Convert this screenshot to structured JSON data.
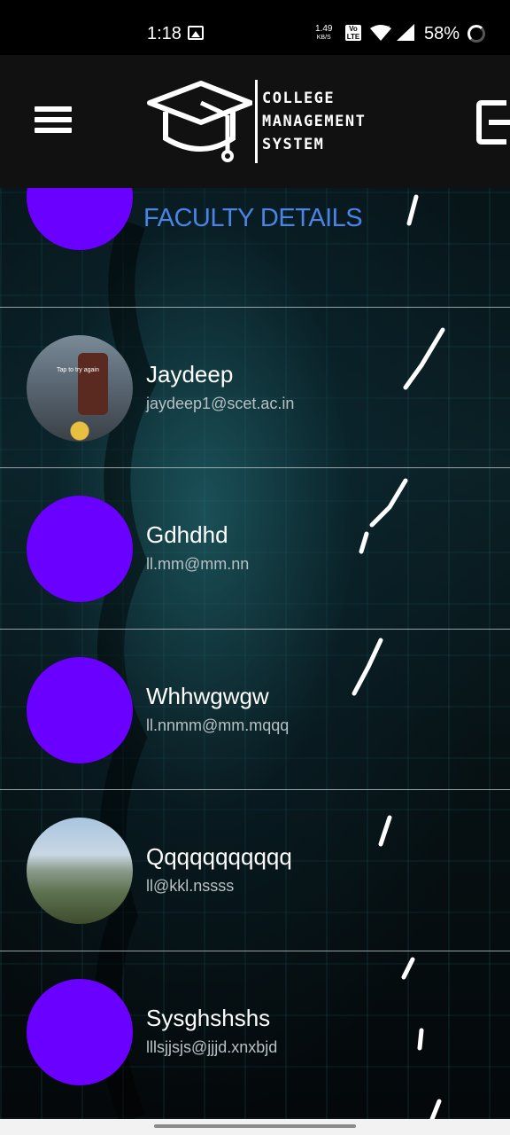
{
  "status_bar": {
    "time": "1:18",
    "net_speed_value": "1.49",
    "net_speed_unit": "KB/S",
    "lte": "Vo LTE",
    "battery": "58%"
  },
  "header": {
    "logo_line1": "COLLEGE",
    "logo_line2": "MANAGEMENT",
    "logo_line3": "SYSTEM"
  },
  "page": {
    "title": "FACULTY DETAILS"
  },
  "colors": {
    "accent": "#6a00ff",
    "title": "#4a84e6"
  },
  "faculty": [
    {
      "name": "Jaydeep",
      "email": "jaydeep1@scet.ac.in",
      "avatar": "photo",
      "photo_caption": "Tap to try again"
    },
    {
      "name": "Gdhdhd",
      "email": "ll.mm@mm.nn",
      "avatar": "placeholder"
    },
    {
      "name": "Whhwgwgw",
      "email": "ll.nnmm@mm.mqqq",
      "avatar": "placeholder"
    },
    {
      "name": "Qqqqqqqqqqq",
      "email": "ll@kkl.nssss",
      "avatar": "photo"
    },
    {
      "name": "Sysghshshs",
      "email": "lllsjjsjs@jjjd.xnxbjd",
      "avatar": "placeholder"
    }
  ]
}
